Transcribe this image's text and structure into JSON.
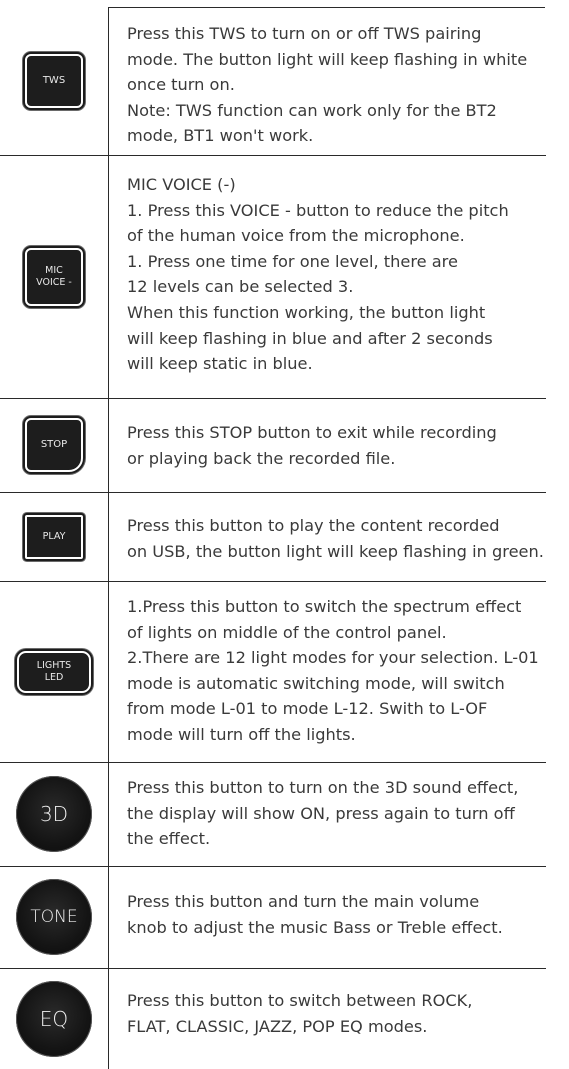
{
  "rows": [
    {
      "icon": {
        "label": "TWS",
        "shape": "square-button",
        "icon_name": "tws-button-icon"
      },
      "text": "Press this TWS to turn on or off TWS pairing\nmode. The button light will keep flashing in white\nonce turn on.\nNote: TWS function can work only for the BT2\nmode, BT1 won't work."
    },
    {
      "icon": {
        "label": "MIC\nVOICE -",
        "shape": "square-button",
        "icon_name": "mic-voice-minus-button-icon"
      },
      "text": "MIC VOICE (-)\n1. Press this VOICE - button to reduce the pitch\nof the human voice from the microphone.\n1. Press one time for one level, there are\n12 levels can be selected 3.\nWhen this function working, the button light\nwill keep flashing in blue and after 2 seconds\nwill keep static in blue."
    },
    {
      "icon": {
        "label": "STOP",
        "shape": "square-button",
        "icon_name": "stop-button-icon"
      },
      "text": "Press this STOP button to exit while recording\nor playing back the recorded file."
    },
    {
      "icon": {
        "label": "PLAY",
        "shape": "square-button",
        "icon_name": "play-button-icon"
      },
      "text": "Press this button to play the content recorded\non USB, the button light will keep flashing in green."
    },
    {
      "icon": {
        "label": "LIGHTS\nLED",
        "shape": "rounded-button",
        "icon_name": "lights-led-button-icon"
      },
      "text": "1.Press this button to switch the spectrum effect\nof lights on middle of the control panel.\n2.There are 12 light modes for your selection. L-01\nmode is automatic switching mode, will switch\nfrom mode L-01 to mode L-12. Swith to L-OF\nmode will turn off the lights."
    },
    {
      "icon": {
        "label": "3D",
        "shape": "round-knob",
        "icon_name": "3d-button-icon"
      },
      "text": "Press this button to turn on the 3D sound effect,\nthe display will show ON, press again to turn off\nthe effect."
    },
    {
      "icon": {
        "label": "TONE",
        "shape": "round-knob",
        "icon_name": "tone-button-icon"
      },
      "text": "Press this button and turn the main volume\nknob to adjust the music Bass or Treble effect."
    },
    {
      "icon": {
        "label": "EQ",
        "shape": "round-knob",
        "icon_name": "eq-button-icon"
      },
      "text": "Press this button to switch between ROCK,\nFLAT, CLASSIC, JAZZ, POP  EQ modes."
    }
  ]
}
